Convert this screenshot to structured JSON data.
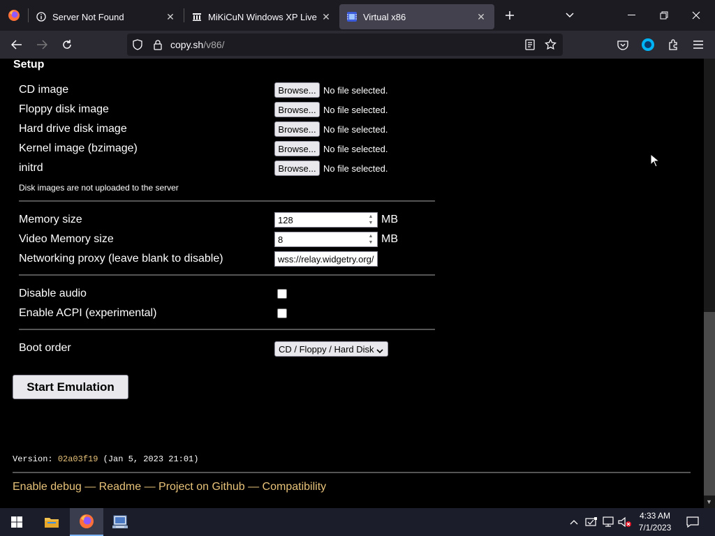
{
  "browser": {
    "tabs": [
      {
        "title": "Server Not Found",
        "icon": "info-icon",
        "active": false
      },
      {
        "title": "MiKiCuN Windows XP Live CD",
        "icon": "archive-icon",
        "active": false
      },
      {
        "title": "Virtual x86",
        "icon": "v86-icon",
        "active": true
      }
    ],
    "url_domain": "copy.sh",
    "url_path": "/v86/"
  },
  "setup": {
    "heading": "Setup",
    "file_inputs": [
      {
        "label": "CD image",
        "button": "Browse...",
        "status": "No file selected."
      },
      {
        "label": "Floppy disk image",
        "button": "Browse...",
        "status": "No file selected."
      },
      {
        "label": "Hard drive disk image",
        "button": "Browse...",
        "status": "No file selected."
      },
      {
        "label": "Kernel image (bzimage)",
        "button": "Browse...",
        "status": "No file selected."
      },
      {
        "label": "initrd",
        "button": "Browse...",
        "status": "No file selected."
      }
    ],
    "disk_note": "Disk images are not uploaded to the server",
    "memory_label": "Memory size",
    "memory_value": "128",
    "memory_unit": "MB",
    "vmem_label": "Video Memory size",
    "vmem_value": "8",
    "vmem_unit": "MB",
    "proxy_label": "Networking proxy (leave blank to disable)",
    "proxy_value": "wss://relay.widgetry.org/",
    "disable_audio_label": "Disable audio",
    "acpi_label": "Enable ACPI (experimental)",
    "boot_order_label": "Boot order",
    "boot_order_value": "CD / Floppy / Hard Disk",
    "start_button": "Start Emulation"
  },
  "footer": {
    "version_prefix": "Version: ",
    "version_hash": "02a03f19",
    "version_date": " (Jan 5, 2023 21:01)",
    "links": [
      "Enable debug",
      "Readme",
      "Project on Github",
      "Compatibility"
    ],
    "separator": " — "
  },
  "taskbar": {
    "time": "4:33 AM",
    "date": "7/1/2023"
  },
  "colors": {
    "link": "#e8c37a",
    "background": "#000000",
    "active_tab": "#42414d"
  }
}
